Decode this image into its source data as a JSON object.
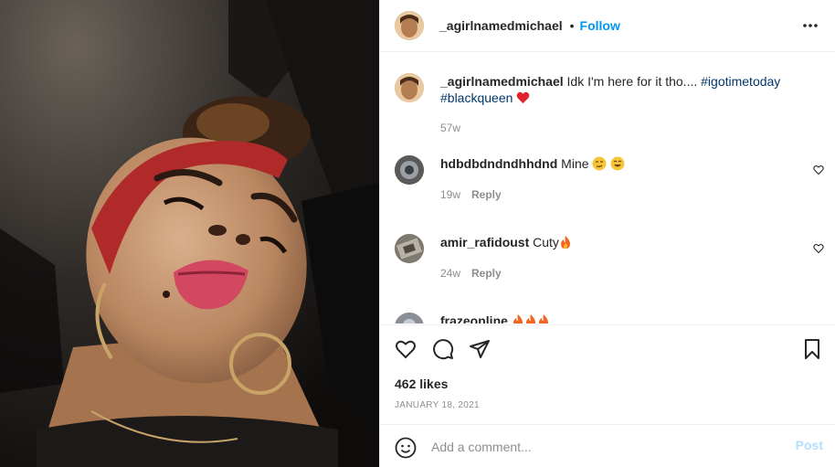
{
  "post": {
    "author": "_agirlnamedmichael",
    "separator": "•",
    "follow_label": "Follow",
    "more_icon": "more-horizontal-icon",
    "caption": {
      "text": "Idk I'm here for it tho....",
      "hashtag1": "#igotimetoday",
      "hashtag2": "#blackqueen",
      "emoji": "heart-emoji",
      "age": "57w"
    }
  },
  "comments": [
    {
      "user": "hdbdbdndndhhdnd",
      "text": "Mine",
      "age": "19w",
      "reply_label": "Reply"
    },
    {
      "user": "amir_rafidoust",
      "text": "Cuty",
      "age": "24w",
      "reply_label": "Reply"
    },
    {
      "user": "frazeonline",
      "text": "",
      "age": "",
      "reply_label": ""
    }
  ],
  "actions": {
    "icons": [
      "heart-icon",
      "comment-icon",
      "share-icon",
      "bookmark-icon"
    ],
    "likes": "462 likes",
    "date": "JANUARY 18, 2021"
  },
  "add_comment": {
    "placeholder": "Add a comment...",
    "post_label": "Post"
  },
  "colors": {
    "accent": "#0095f6",
    "post_disabled": "#b2dffc",
    "hashtag": "#00376b",
    "muted": "#8e8e8e"
  }
}
